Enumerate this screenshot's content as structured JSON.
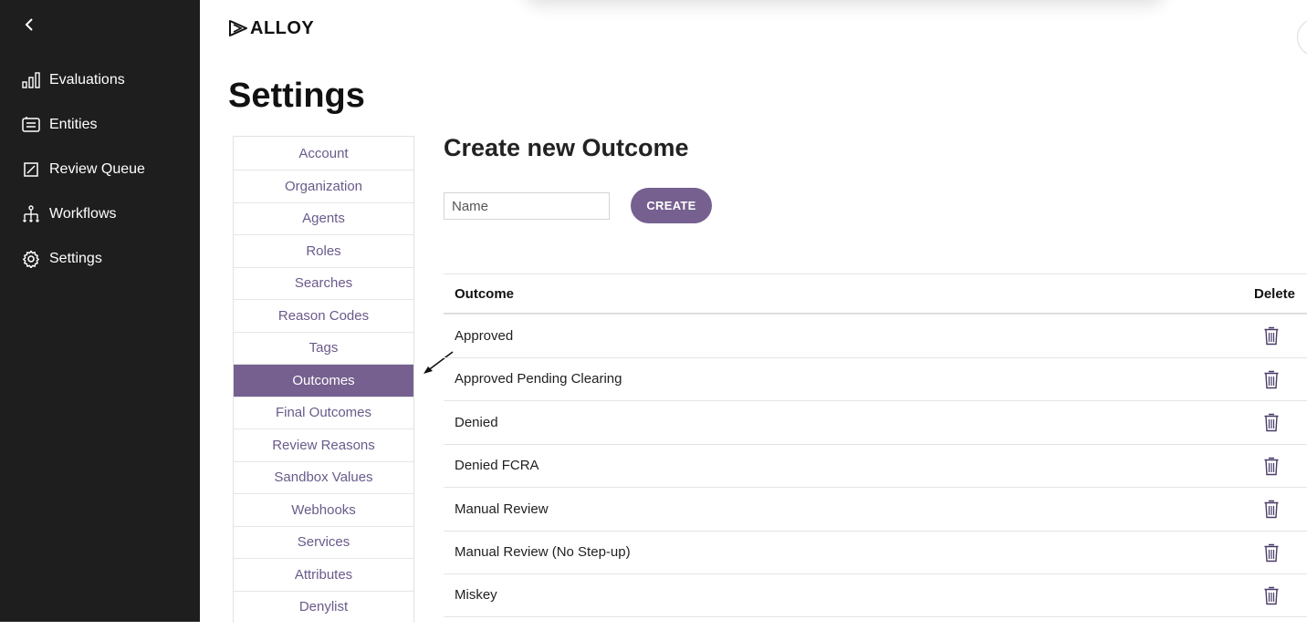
{
  "sidebar": {
    "back_icon": "chevron-left-icon",
    "items": [
      {
        "label": "Evaluations",
        "icon": "bar-chart-icon"
      },
      {
        "label": "Entities",
        "icon": "id-card-icon"
      },
      {
        "label": "Review Queue",
        "icon": "edit-square-icon"
      },
      {
        "label": "Workflows",
        "icon": "hierarchy-icon"
      },
      {
        "label": "Settings",
        "icon": "gear-icon"
      }
    ]
  },
  "brand": {
    "name": "ALLOY"
  },
  "page": {
    "title": "Settings"
  },
  "settings_tabs": [
    {
      "label": "Account",
      "active": false
    },
    {
      "label": "Organization",
      "active": false
    },
    {
      "label": "Agents",
      "active": false
    },
    {
      "label": "Roles",
      "active": false
    },
    {
      "label": "Searches",
      "active": false
    },
    {
      "label": "Reason Codes",
      "active": false
    },
    {
      "label": "Tags",
      "active": false
    },
    {
      "label": "Outcomes",
      "active": true
    },
    {
      "label": "Final Outcomes",
      "active": false
    },
    {
      "label": "Review Reasons",
      "active": false
    },
    {
      "label": "Sandbox Values",
      "active": false
    },
    {
      "label": "Webhooks",
      "active": false
    },
    {
      "label": "Services",
      "active": false
    },
    {
      "label": "Attributes",
      "active": false
    },
    {
      "label": "Denylist",
      "active": false
    }
  ],
  "create_form": {
    "title": "Create new Outcome",
    "name_placeholder": "Name",
    "name_value": "",
    "create_label": "CREATE"
  },
  "outcomes_table": {
    "columns": {
      "outcome": "Outcome",
      "delete": "Delete"
    },
    "rows": [
      "Approved",
      "Approved Pending Clearing",
      "Denied",
      "Denied FCRA",
      "Manual Review",
      "Manual Review (No Step-up)",
      "Miskey"
    ]
  },
  "colors": {
    "sidebar_bg": "#1e1e1e",
    "accent": "#75608f",
    "tab_text": "#6a5a8a"
  }
}
